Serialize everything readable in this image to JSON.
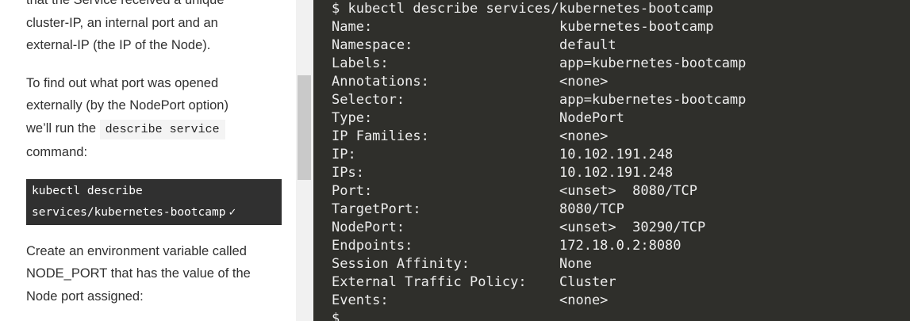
{
  "instructions": {
    "para1_lines": [
      "that the Service received a unique",
      "cluster-IP, an internal port and an",
      "external-IP (the IP of the Node)."
    ],
    "para2_line1": "To find out what port was opened",
    "para2_line2": "externally (by the NodePort option)",
    "para2_line3_prefix": "we’ll run the",
    "para2_code": "describe service",
    "para2_line4": "command:",
    "command_lines": [
      "kubectl describe",
      "services/kubernetes-bootcamp"
    ],
    "command_check": "✓",
    "para3_lines": [
      "Create an environment variable called",
      "NODE_PORT that has the value of the",
      "Node port assigned:"
    ]
  },
  "terminal": {
    "command": "$ kubectl describe services/kubernetes-bootcamp",
    "rows": [
      {
        "key": "Name:",
        "value": "kubernetes-bootcamp"
      },
      {
        "key": "Namespace:",
        "value": "default"
      },
      {
        "key": "Labels:",
        "value": "app=kubernetes-bootcamp"
      },
      {
        "key": "Annotations:",
        "value": "<none>"
      },
      {
        "key": "Selector:",
        "value": "app=kubernetes-bootcamp"
      },
      {
        "key": "Type:",
        "value": "NodePort"
      },
      {
        "key": "IP Families:",
        "value": "<none>"
      },
      {
        "key": "IP:",
        "value": "10.102.191.248"
      },
      {
        "key": "IPs:",
        "value": "10.102.191.248"
      },
      {
        "key": "Port:",
        "value": "<unset>  8080/TCP"
      },
      {
        "key": "TargetPort:",
        "value": "8080/TCP"
      },
      {
        "key": "NodePort:",
        "value": "<unset>  30290/TCP"
      },
      {
        "key": "Endpoints:",
        "value": "172.18.0.2:8080"
      },
      {
        "key": "Session Affinity:",
        "value": "None"
      },
      {
        "key": "External Traffic Policy:",
        "value": "Cluster"
      },
      {
        "key": "Events:",
        "value": "<none>"
      }
    ],
    "prompt": "$"
  }
}
